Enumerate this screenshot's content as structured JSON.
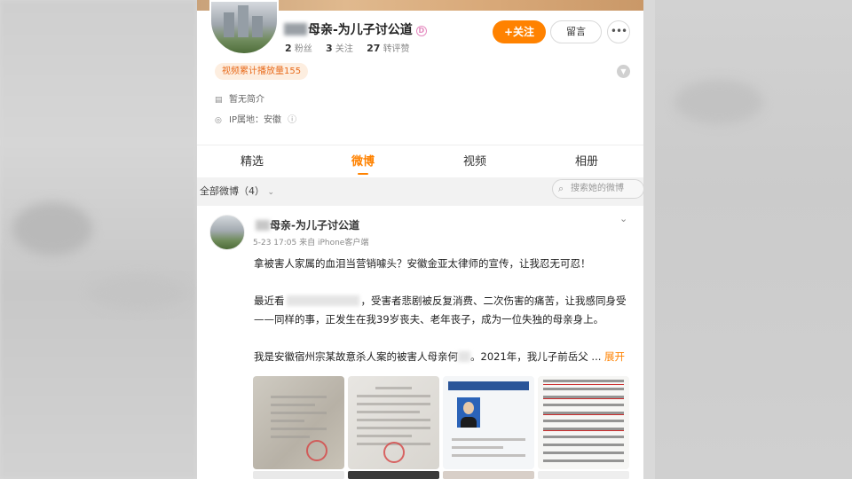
{
  "profile": {
    "name_suffix": "母亲-为儿子讨公道",
    "verified_badge": "D",
    "stats": [
      {
        "num": "2",
        "label": "粉丝"
      },
      {
        "num": "3",
        "label": "关注"
      },
      {
        "num": "27",
        "label": "转评赞"
      }
    ],
    "follow_button": "+关注",
    "message_button": "留言",
    "more_button": "•••",
    "play_count": "视频累计播放量155",
    "bio": "暂无简介",
    "ip_location": "IP属地：安徽"
  },
  "tabs": [
    "精选",
    "微博",
    "视频",
    "相册"
  ],
  "active_tab": "微博",
  "filter": {
    "label": "全部微博（4）",
    "search_placeholder": "搜索她的微博"
  },
  "post": {
    "author_suffix": "母亲-为儿子讨公道",
    "meta": "5-23 17:05 来自 iPhone客户端",
    "para1": "拿被害人家属的血泪当营销噱头？安徽金亚太律师的宣传，让我忍无可忍！",
    "para2_start": "最近看",
    "para2_rest": "，受害者悲剧被反复消费、二次伤害的痛苦，让我感同身受——同样的事，正发生在我39岁丧夫、老年丧子，成为一位失独的母亲身上。",
    "para3_start": "我是安徽宿州宗某故意杀人案的被害人母亲何",
    "para3_rest": "。2021年，我儿子前岳父 ...",
    "expand": "展开"
  },
  "colors": {
    "accent": "#ff8200",
    "page_bg": "#f2f2f2"
  }
}
